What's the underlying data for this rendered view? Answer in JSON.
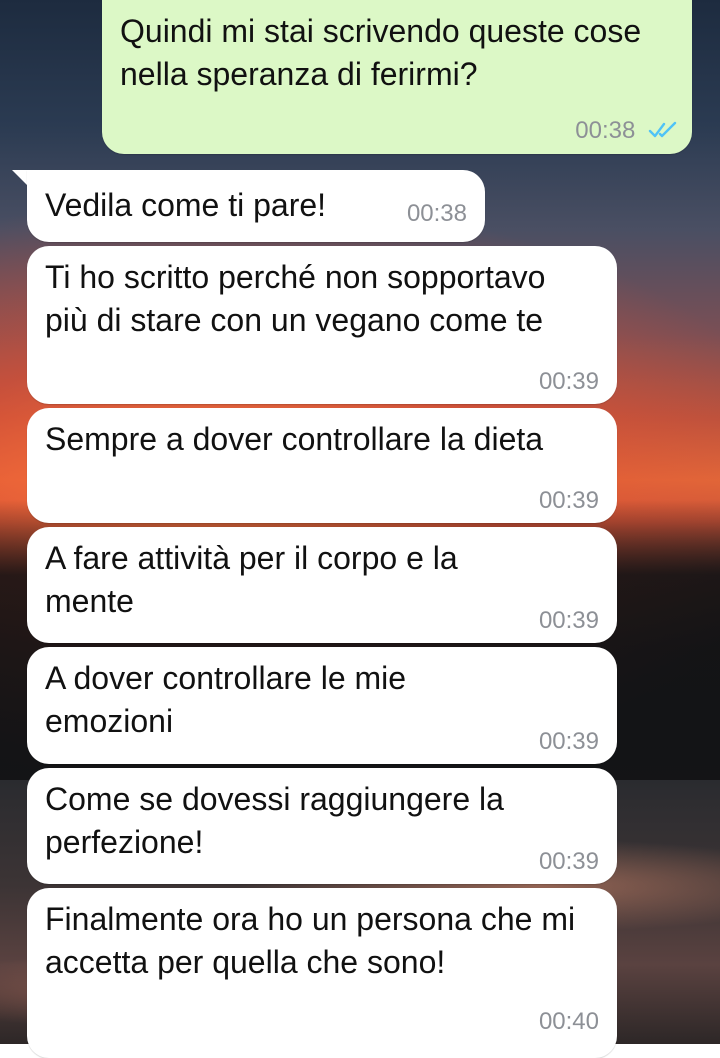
{
  "messages": [
    {
      "direction": "out",
      "text": "Quindi mi stai scrivendo queste cose nella speranza di ferirmi?",
      "time": "00:38",
      "status": "read-ticks-icon"
    },
    {
      "direction": "in",
      "text": "Vedila come ti pare!",
      "time": "00:38"
    },
    {
      "direction": "in",
      "text": "Ti ho scritto perché non sopportavo più di stare con un vegano come te",
      "time": "00:39"
    },
    {
      "direction": "in",
      "text": "Sempre a dover controllare la dieta",
      "time": "00:39"
    },
    {
      "direction": "in",
      "text": "A fare attività per il corpo e la mente",
      "time": "00:39"
    },
    {
      "direction": "in",
      "text": "A dover controllare le mie emozioni",
      "time": "00:39"
    },
    {
      "direction": "in",
      "text": "Come se dovessi raggiungere la perfezione!",
      "time": "00:39"
    },
    {
      "direction": "in",
      "text": "Finalmente ora ho un persona che mi accetta per quella che sono!",
      "time": "00:40"
    }
  ],
  "colors": {
    "outgoing_bubble": "#dcf8c6",
    "incoming_bubble": "#ffffff",
    "timestamp": "#8d9096",
    "read_ticks": "#4fc3f7"
  }
}
